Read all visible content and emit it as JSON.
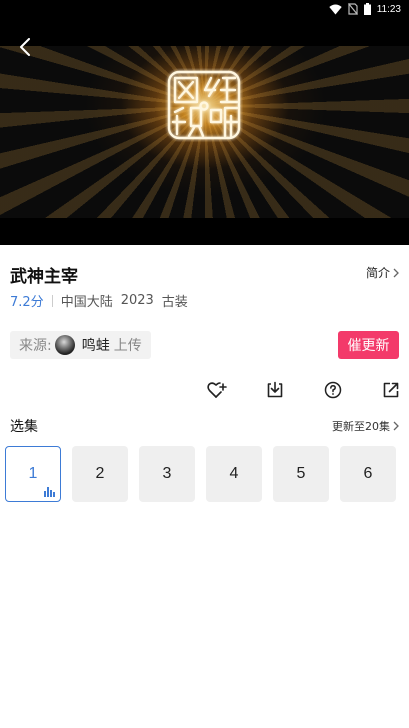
{
  "status_bar": {
    "time": "11:23",
    "icons": [
      "wifi-icon",
      "no-sim-icon",
      "battery-icon"
    ]
  },
  "player": {
    "logo_characters": [
      "网",
      "络",
      "视",
      "听"
    ]
  },
  "show": {
    "title": "武神主宰",
    "intro_label": "简介",
    "score": "7.2分",
    "tags": [
      "中国大陆",
      "2023",
      "古装"
    ]
  },
  "source": {
    "label": "来源:",
    "user": "鸣蛙",
    "suffix": "上传"
  },
  "urge_button": "催更新",
  "actions": [
    "favorite-add-icon",
    "download-icon",
    "help-icon",
    "share-icon"
  ],
  "episodes_section": {
    "title": "选集",
    "update_text": "更新至20集",
    "episodes": [
      "1",
      "2",
      "3",
      "4",
      "5",
      "6"
    ],
    "active_index": 0
  },
  "colors": {
    "accent_blue": "#3d7bd6",
    "urge_pink": "#f33a6a"
  }
}
